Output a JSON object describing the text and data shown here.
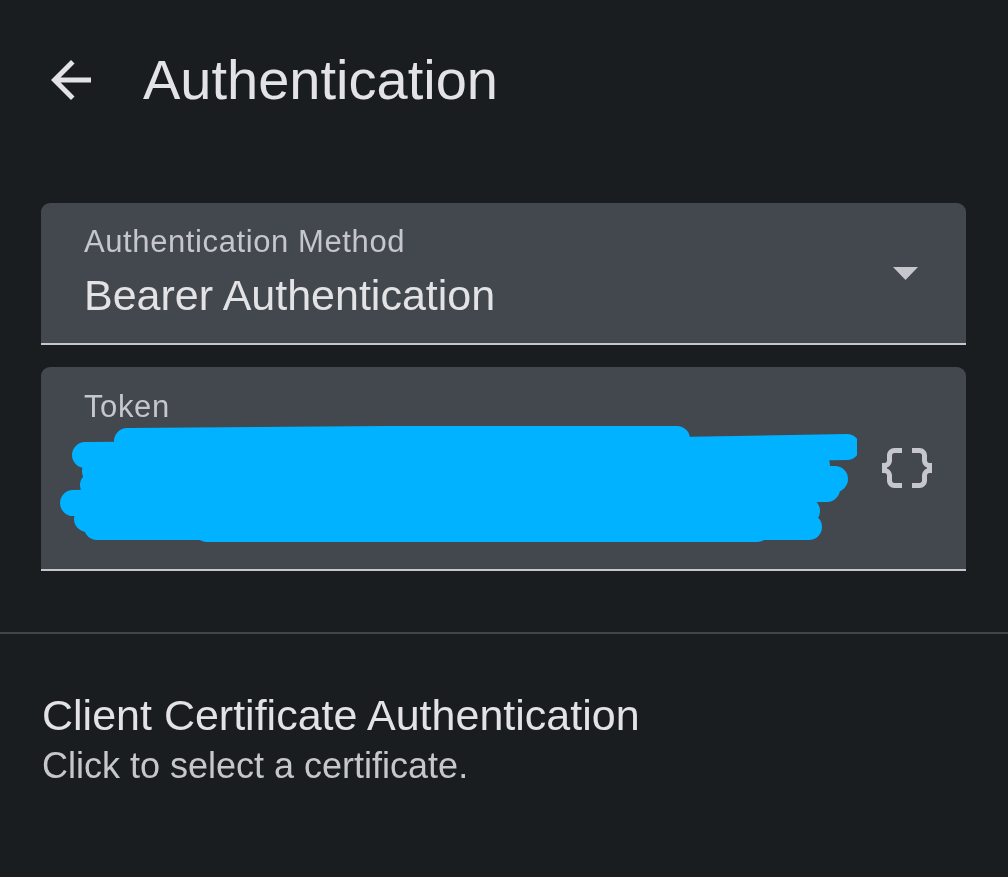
{
  "header": {
    "title": "Authentication"
  },
  "method_select": {
    "label": "Authentication Method",
    "value": "Bearer Authentication"
  },
  "token_field": {
    "label": "Token",
    "redacted": true
  },
  "client_certificate": {
    "title": "Client Certificate Authentication",
    "subtitle": "Click to select a certificate."
  }
}
